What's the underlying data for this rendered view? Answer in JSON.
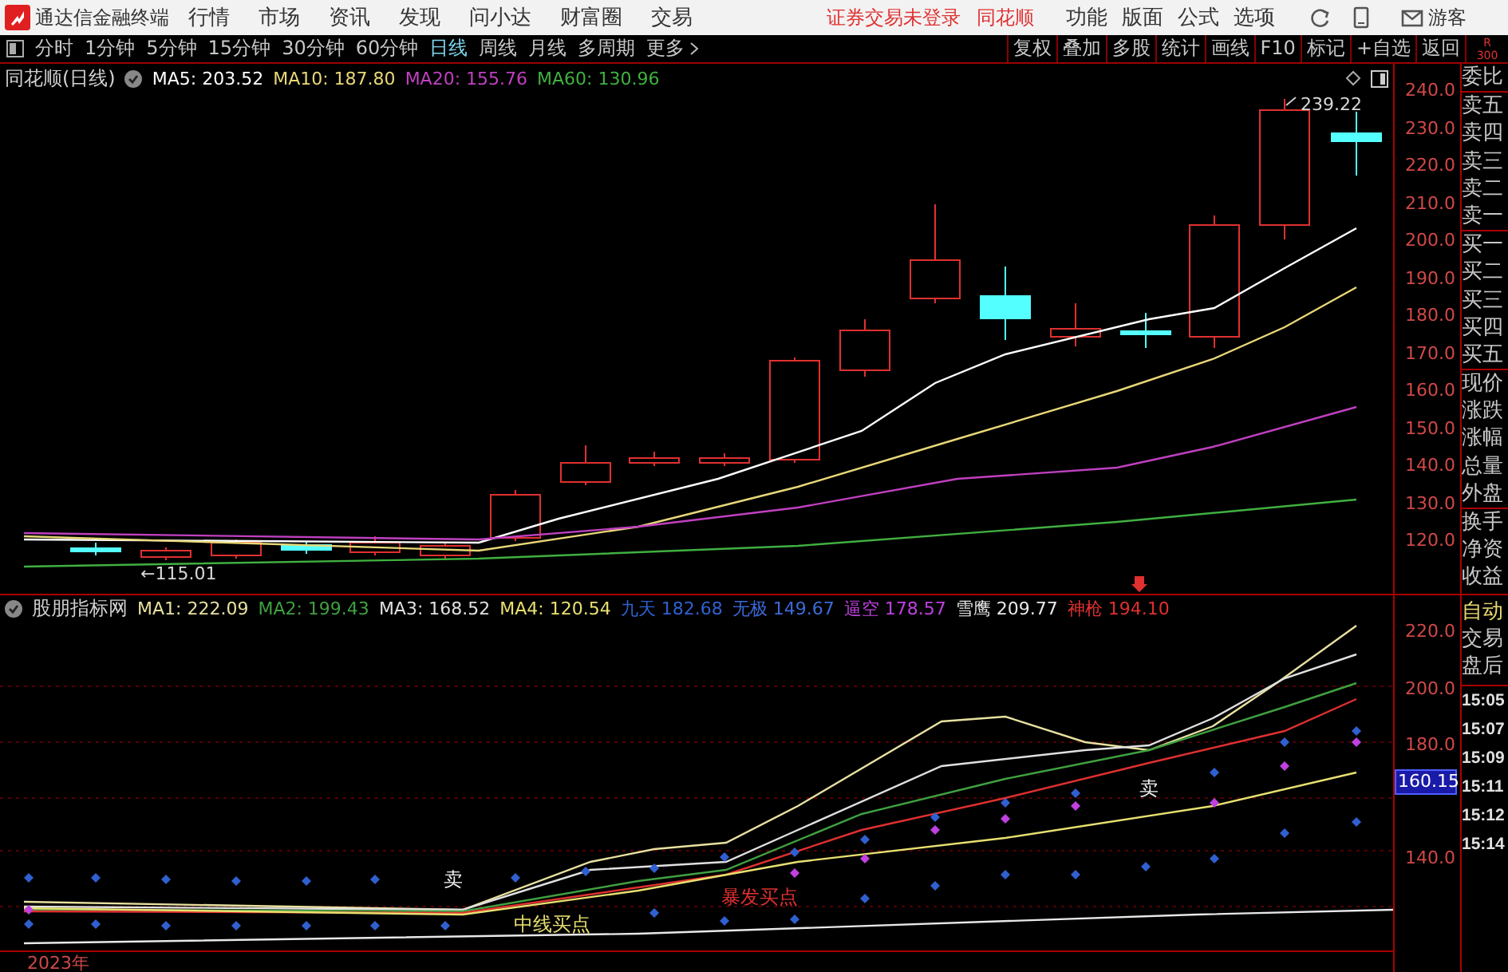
{
  "app": {
    "title": "通达信金融终端"
  },
  "menu": [
    "行情",
    "市场",
    "资讯",
    "发现",
    "问小达",
    "财富圈",
    "交易"
  ],
  "login_notice": {
    "status": "证券交易未登录",
    "broker": "同花顺"
  },
  "right_menu": [
    "功能",
    "版面",
    "公式",
    "选项"
  ],
  "user": "游客",
  "periods": [
    {
      "label": "分时",
      "selected": false
    },
    {
      "label": "1分钟",
      "selected": false
    },
    {
      "label": "5分钟",
      "selected": false
    },
    {
      "label": "15分钟",
      "selected": false
    },
    {
      "label": "30分钟",
      "selected": false
    },
    {
      "label": "60分钟",
      "selected": false
    },
    {
      "label": "日线",
      "selected": true
    },
    {
      "label": "周线",
      "selected": false
    },
    {
      "label": "月线",
      "selected": false
    },
    {
      "label": "多周期",
      "selected": false
    },
    {
      "label": "更多",
      "selected": false
    }
  ],
  "tools": [
    "复权",
    "叠加",
    "多股",
    "统计",
    "画线",
    "F10",
    "标记",
    "+自选",
    "返回"
  ],
  "corner": {
    "letter": "R",
    "number": "300"
  },
  "price_chart": {
    "title": "同花顺(日线)",
    "indicators": [
      {
        "label": "MA5: 203.52",
        "color": "#ffffff"
      },
      {
        "label": "MA10: 187.80",
        "color": "#e8d878"
      },
      {
        "label": "MA20: 155.76",
        "color": "#c040c0"
      },
      {
        "label": "MA60: 130.96",
        "color": "#40b040"
      }
    ],
    "axis": [
      "240.0",
      "230.0",
      "220.0",
      "210.0",
      "200.0",
      "190.0",
      "180.0",
      "170.0",
      "160.0",
      "150.0",
      "140.0",
      "130.0",
      "120.0"
    ],
    "high_label": "239.22",
    "low_label": "←115.01"
  },
  "indicator_chart": {
    "title": "股朋指标网",
    "indicators": [
      {
        "label": "MA1: 222.09",
        "color": "#e8e0a0"
      },
      {
        "label": "MA2: 199.43",
        "color": "#40a040"
      },
      {
        "label": "MA3: 168.52",
        "color": "#e0e0e0"
      },
      {
        "label": "MA4: 120.54",
        "color": "#e8e070"
      },
      {
        "label": "九天 182.68",
        "color": "#3060d0"
      },
      {
        "label": "无极 149.67",
        "color": "#3c6ad8"
      },
      {
        "label": "逼空 178.57",
        "color": "#c040e0"
      },
      {
        "label": "雪鹰 209.77",
        "color": "#e8e8e8"
      },
      {
        "label": "神枪 194.10",
        "color": "#e03030"
      }
    ],
    "axis": [
      "220.0",
      "200.0",
      "180.0",
      "140.0"
    ],
    "current_value": "160.15",
    "signals": [
      {
        "text": "卖",
        "kind": "sell"
      },
      {
        "text": "卖",
        "kind": "sell"
      },
      {
        "text": "中线买点",
        "kind": "mid_buy"
      },
      {
        "text": "暴发买点",
        "kind": "burst_buy"
      }
    ],
    "year": "2023年"
  },
  "quote_panel": {
    "groups": [
      [
        "委比"
      ],
      [
        "卖五",
        "卖四",
        "卖三",
        "卖二",
        "卖一"
      ],
      [
        "买一",
        "买二",
        "买三",
        "买四",
        "买五"
      ],
      [
        "现价",
        "涨跌",
        "涨幅",
        "总量",
        "外盘"
      ],
      [
        "换手",
        "净资",
        "收益"
      ]
    ],
    "modes": [
      {
        "label": "自动",
        "selected": true
      },
      {
        "label": "交易",
        "selected": false
      },
      {
        "label": "盘后",
        "selected": false
      }
    ],
    "times": [
      "15:05",
      "15:07",
      "15:09",
      "15:11",
      "15:12",
      "15:14"
    ]
  }
}
